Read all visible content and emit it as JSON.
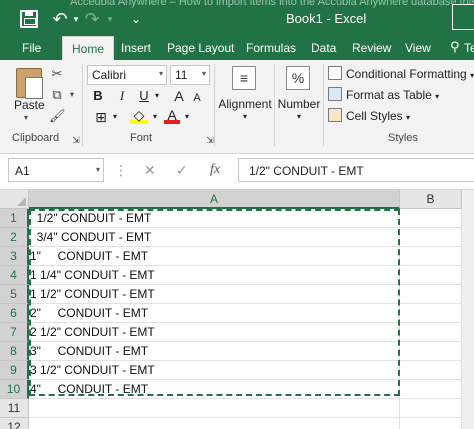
{
  "titlebar": {
    "background_text": "Accéubla Anywhere – How to import items into the Accubla Anywhere database this",
    "window_title": "Book1 - Excel"
  },
  "tabs": [
    "File",
    "Home",
    "Insert",
    "Page Layout",
    "Formulas",
    "Data",
    "Review",
    "View"
  ],
  "tell_me": "Te",
  "ribbon": {
    "clipboard": {
      "paste_label": "Paste",
      "group_label": "Clipboard"
    },
    "font": {
      "name": "Calibri",
      "size": "11",
      "bold": "B",
      "italic": "I",
      "underline": "U",
      "grow": "A",
      "shrink": "A",
      "group_label": "Font"
    },
    "alignment": {
      "label": "Alignment"
    },
    "number": {
      "label": "Number",
      "icon_text": "%"
    },
    "styles": {
      "conditional_formatting": "Conditional Formatting",
      "format_as_table": "Format as Table",
      "cell_styles": "Cell Styles",
      "group_label": "Styles"
    }
  },
  "formula_bar": {
    "name_box": "A1",
    "cancel_glyph": "✕",
    "enter_glyph": "✓",
    "fx_glyph": "fx",
    "formula": "1/2\" CONDUIT - EMT"
  },
  "grid": {
    "columns": [
      "A",
      "B"
    ],
    "rows": [
      {
        "n": "1",
        "a": "  1/2\" CONDUIT - EMT"
      },
      {
        "n": "2",
        "a": "  3/4\" CONDUIT - EMT"
      },
      {
        "n": "3",
        "a": "1\"     CONDUIT - EMT"
      },
      {
        "n": "4",
        "a": "1 1/4\" CONDUIT - EMT"
      },
      {
        "n": "5",
        "a": "1 1/2\" CONDUIT - EMT"
      },
      {
        "n": "6",
        "a": "2\"     CONDUIT - EMT"
      },
      {
        "n": "7",
        "a": "2 1/2\" CONDUIT - EMT"
      },
      {
        "n": "8",
        "a": "3\"     CONDUIT - EMT"
      },
      {
        "n": "9",
        "a": "3 1/2\" CONDUIT - EMT"
      },
      {
        "n": "10",
        "a": "4\"     CONDUIT - EMT"
      },
      {
        "n": "11",
        "a": ""
      },
      {
        "n": "12",
        "a": ""
      }
    ]
  },
  "colors": {
    "excel_green": "#217346",
    "ribbon_bg": "#f3f3f3"
  }
}
